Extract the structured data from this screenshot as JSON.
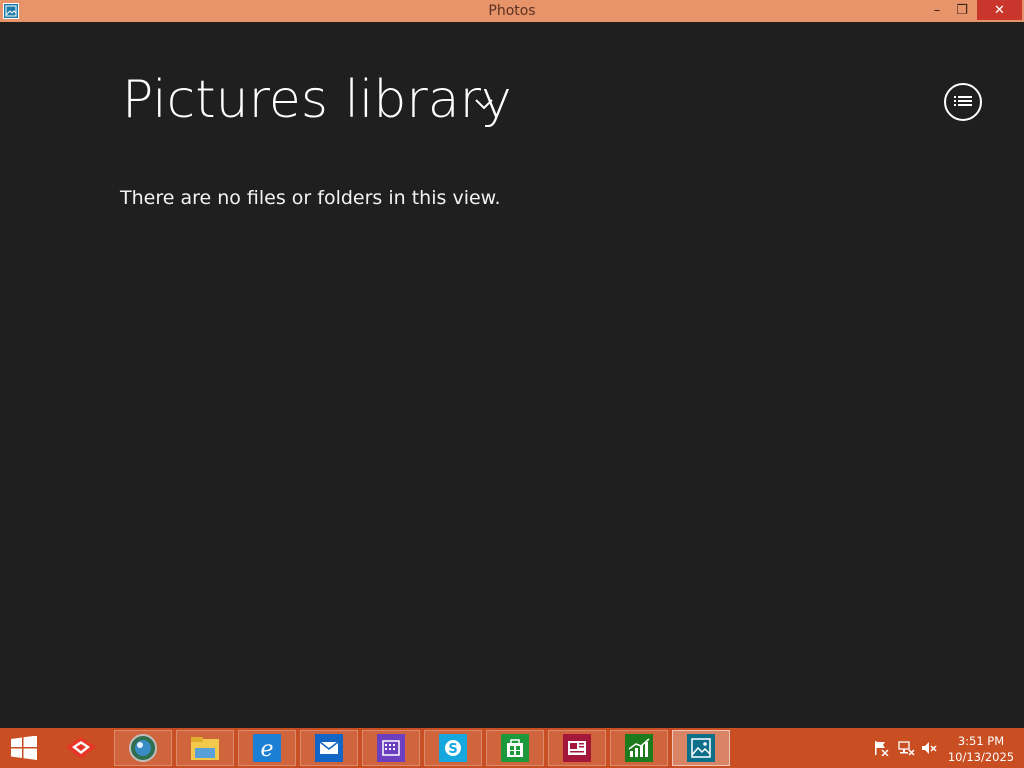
{
  "window": {
    "title": "Photos",
    "controls": {
      "minimize": "–",
      "maximize": "❐",
      "close": "✕"
    }
  },
  "main": {
    "title": "Pictures library",
    "empty_message": "There are no files or folders in this view."
  },
  "taskbar": {
    "apps": [
      {
        "name": "redhat-app-icon"
      },
      {
        "name": "browser-globe-icon"
      },
      {
        "name": "file-explorer-icon"
      },
      {
        "name": "internet-explorer-icon"
      },
      {
        "name": "mail-icon"
      },
      {
        "name": "calendar-icon"
      },
      {
        "name": "skype-icon"
      },
      {
        "name": "store-icon"
      },
      {
        "name": "news-icon"
      },
      {
        "name": "finance-icon"
      },
      {
        "name": "photos-icon"
      }
    ],
    "clock": {
      "time": "3:51 PM",
      "date": "10/13/2025"
    }
  },
  "colors": {
    "background": "#1f1f1f",
    "titlebar": "#e8946a",
    "taskbar": "#c94f23",
    "close": "#c9372c"
  }
}
